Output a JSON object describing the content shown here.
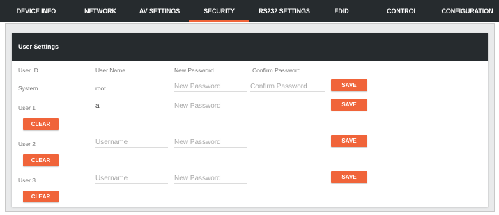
{
  "nav": {
    "tabs": [
      {
        "label": "DEVICE INFO"
      },
      {
        "label": "NETWORK"
      },
      {
        "label": "AV SETTINGS"
      },
      {
        "label": "SECURITY",
        "active": true
      },
      {
        "label": "RS232 SETTINGS"
      },
      {
        "label": "EDID"
      },
      {
        "label": "CONTROL"
      },
      {
        "label": "CONFIGURATION"
      }
    ]
  },
  "card": {
    "title": "User Settings",
    "headers": {
      "user_id": "User ID",
      "user_name": "User Name",
      "new_password": "New Password",
      "confirm_password": "Confirm Password"
    }
  },
  "rows": [
    {
      "id": "System",
      "name": "root",
      "password_placeholder": "New Password",
      "confirm_placeholder": "Confirm Password",
      "save_label": "SAVE"
    },
    {
      "id": "User 1",
      "name_value": "a",
      "password_placeholder": "New Password",
      "save_label": "SAVE",
      "clear_label": "CLEAR"
    },
    {
      "id": "User 2",
      "name_placeholder": "Username",
      "password_placeholder": "New Password",
      "save_label": "SAVE",
      "clear_label": "CLEAR"
    },
    {
      "id": "User 3",
      "name_placeholder": "Username",
      "password_placeholder": "New Password",
      "save_label": "SAVE",
      "clear_label": "CLEAR"
    }
  ],
  "colors": {
    "nav_bg": "#262b2e",
    "accent": "#f0643a",
    "frame_bg": "#e9eaeb"
  }
}
